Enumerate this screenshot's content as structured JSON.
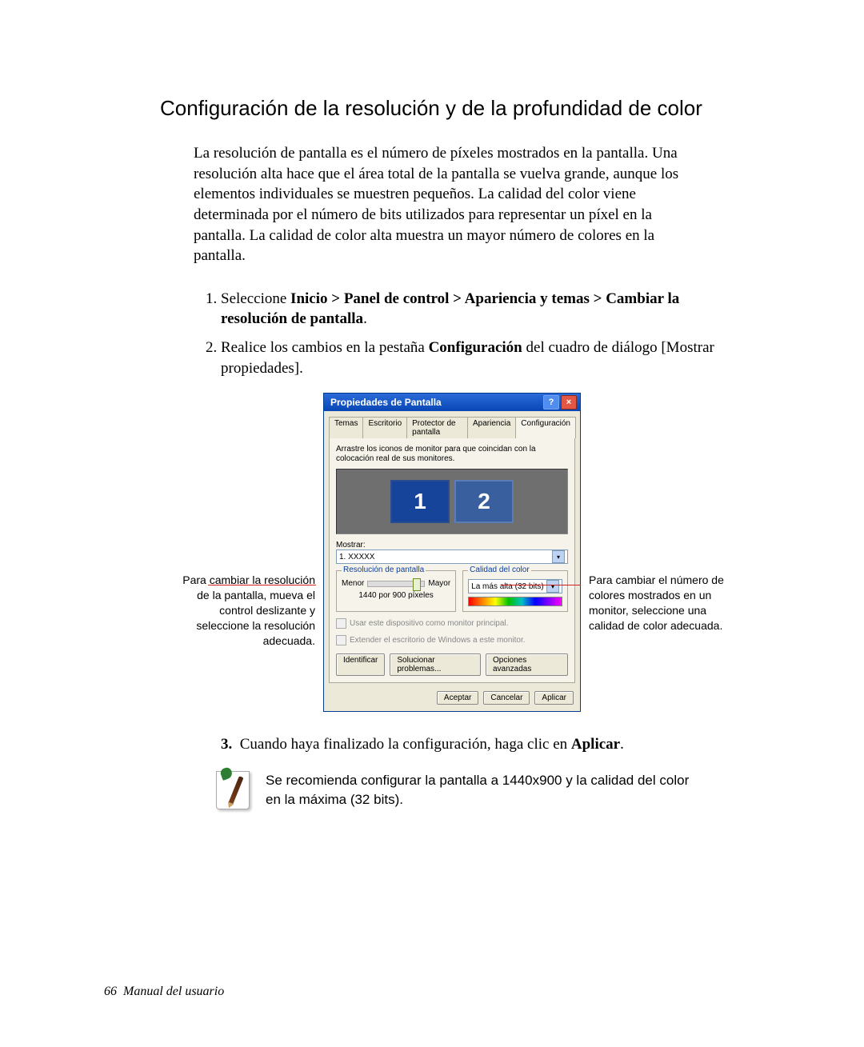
{
  "title": "Configuración de la resolución y de la profundidad de color",
  "intro": "La resolución de pantalla es el número de píxeles mostrados en la pantalla. Una resolución alta hace que el área total de la pantalla se vuelva grande, aunque los elementos individuales se muestren pequeños. La calidad del color viene determinada por el número de bits utilizados para representar un píxel en la pantalla. La calidad de color alta muestra un mayor número de colores en la pantalla.",
  "steps": {
    "s1_pre": "Seleccione ",
    "s1_bold": "Inicio > Panel de control > Apariencia y temas > Cambiar la resolución de pantalla",
    "s1_post": ".",
    "s2_pre": "Realice los cambios en la pestaña ",
    "s2_bold": "Configuración",
    "s2_post": " del cuadro de diálogo [Mostrar propiedades].",
    "s3_pre": "Cuando haya finalizado la configuración, haga clic en ",
    "s3_bold": "Aplicar",
    "s3_post": "."
  },
  "callout_left": "Para cambiar la resolución de la pantalla, mueva el control deslizante y seleccione la resolución adecuada.",
  "callout_right": "Para cambiar el número de colores mostrados en un monitor, seleccione una calidad de color adecuada.",
  "dialog": {
    "title": "Propiedades de Pantalla",
    "help": "?",
    "close": "×",
    "tabs": [
      "Temas",
      "Escritorio",
      "Protector de pantalla",
      "Apariencia",
      "Configuración"
    ],
    "active_tab": 4,
    "instruction": "Arrastre los iconos de monitor para que coincidan con la colocación real de sus monitores.",
    "mon1": "1",
    "mon2": "2",
    "display_label": "Mostrar:",
    "display_value": "1. XXXXX",
    "res_group": "Resolución de pantalla",
    "res_min": "Menor",
    "res_max": "Mayor",
    "res_value": "1440 por 900 píxeles",
    "color_group": "Calidad del color",
    "color_value": "La más alta (32 bits)",
    "chk1": "Usar este dispositivo como monitor principal.",
    "chk2": "Extender el escritorio de Windows a este monitor.",
    "btn_identify": "Identificar",
    "btn_troubleshoot": "Solucionar problemas...",
    "btn_advanced": "Opciones avanzadas",
    "btn_ok": "Aceptar",
    "btn_cancel": "Cancelar",
    "btn_apply": "Aplicar"
  },
  "note": "Se recomienda configurar la pantalla a 1440x900 y la calidad del color en la máxima (32 bits).",
  "footer_page": "66",
  "footer_text": "Manual del usuario"
}
